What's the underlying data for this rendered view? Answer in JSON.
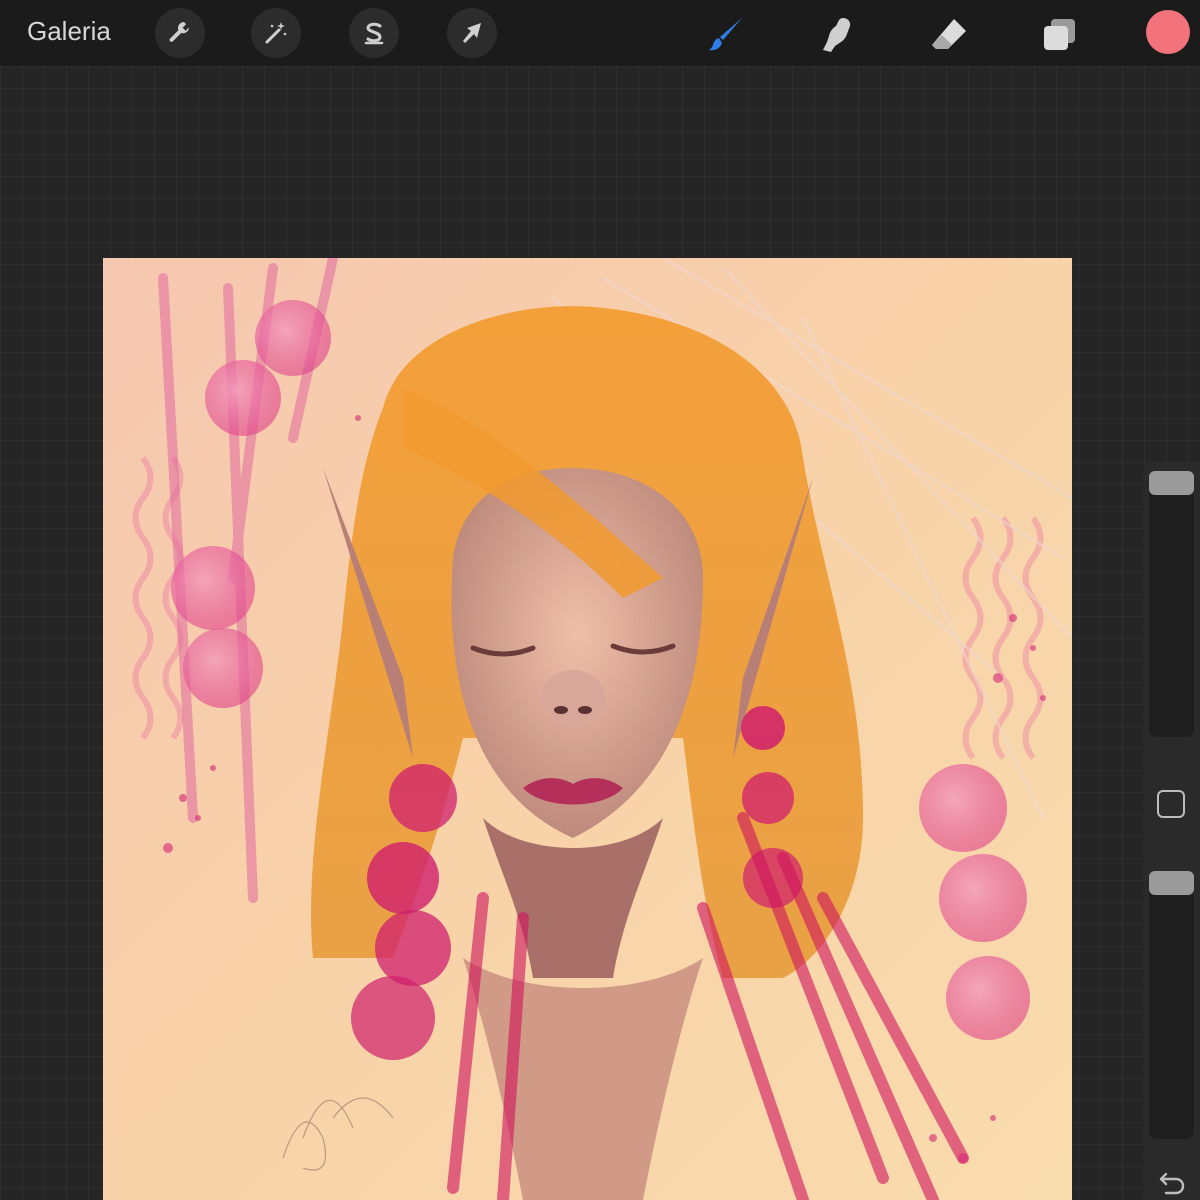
{
  "topbar": {
    "gallery_label": "Galeria",
    "tools_left": [
      {
        "name": "actions",
        "icon": "wrench-icon"
      },
      {
        "name": "adjustments",
        "icon": "magic-wand-icon"
      },
      {
        "name": "selection",
        "icon": "selection-s-icon"
      },
      {
        "name": "transform",
        "icon": "arrow-cursor-icon"
      }
    ],
    "tools_right": [
      {
        "name": "brush",
        "icon": "brush-icon",
        "active": true
      },
      {
        "name": "smudge",
        "icon": "smudge-finger-icon"
      },
      {
        "name": "eraser",
        "icon": "eraser-icon"
      },
      {
        "name": "layers",
        "icon": "layers-icon"
      }
    ],
    "current_color": "#f2737b"
  },
  "sidebar": {
    "brush_size_level": 1.0,
    "opacity_level": 1.0,
    "modify_icon": "square-icon",
    "undo_icon": "undo-arrow-icon"
  },
  "colors": {
    "accent": "#2f7ee6",
    "hair": "#f0a43c",
    "skin": "#e8b6a0",
    "magenta": "#d4227a",
    "canvas_bg": "#f5cfa8"
  }
}
